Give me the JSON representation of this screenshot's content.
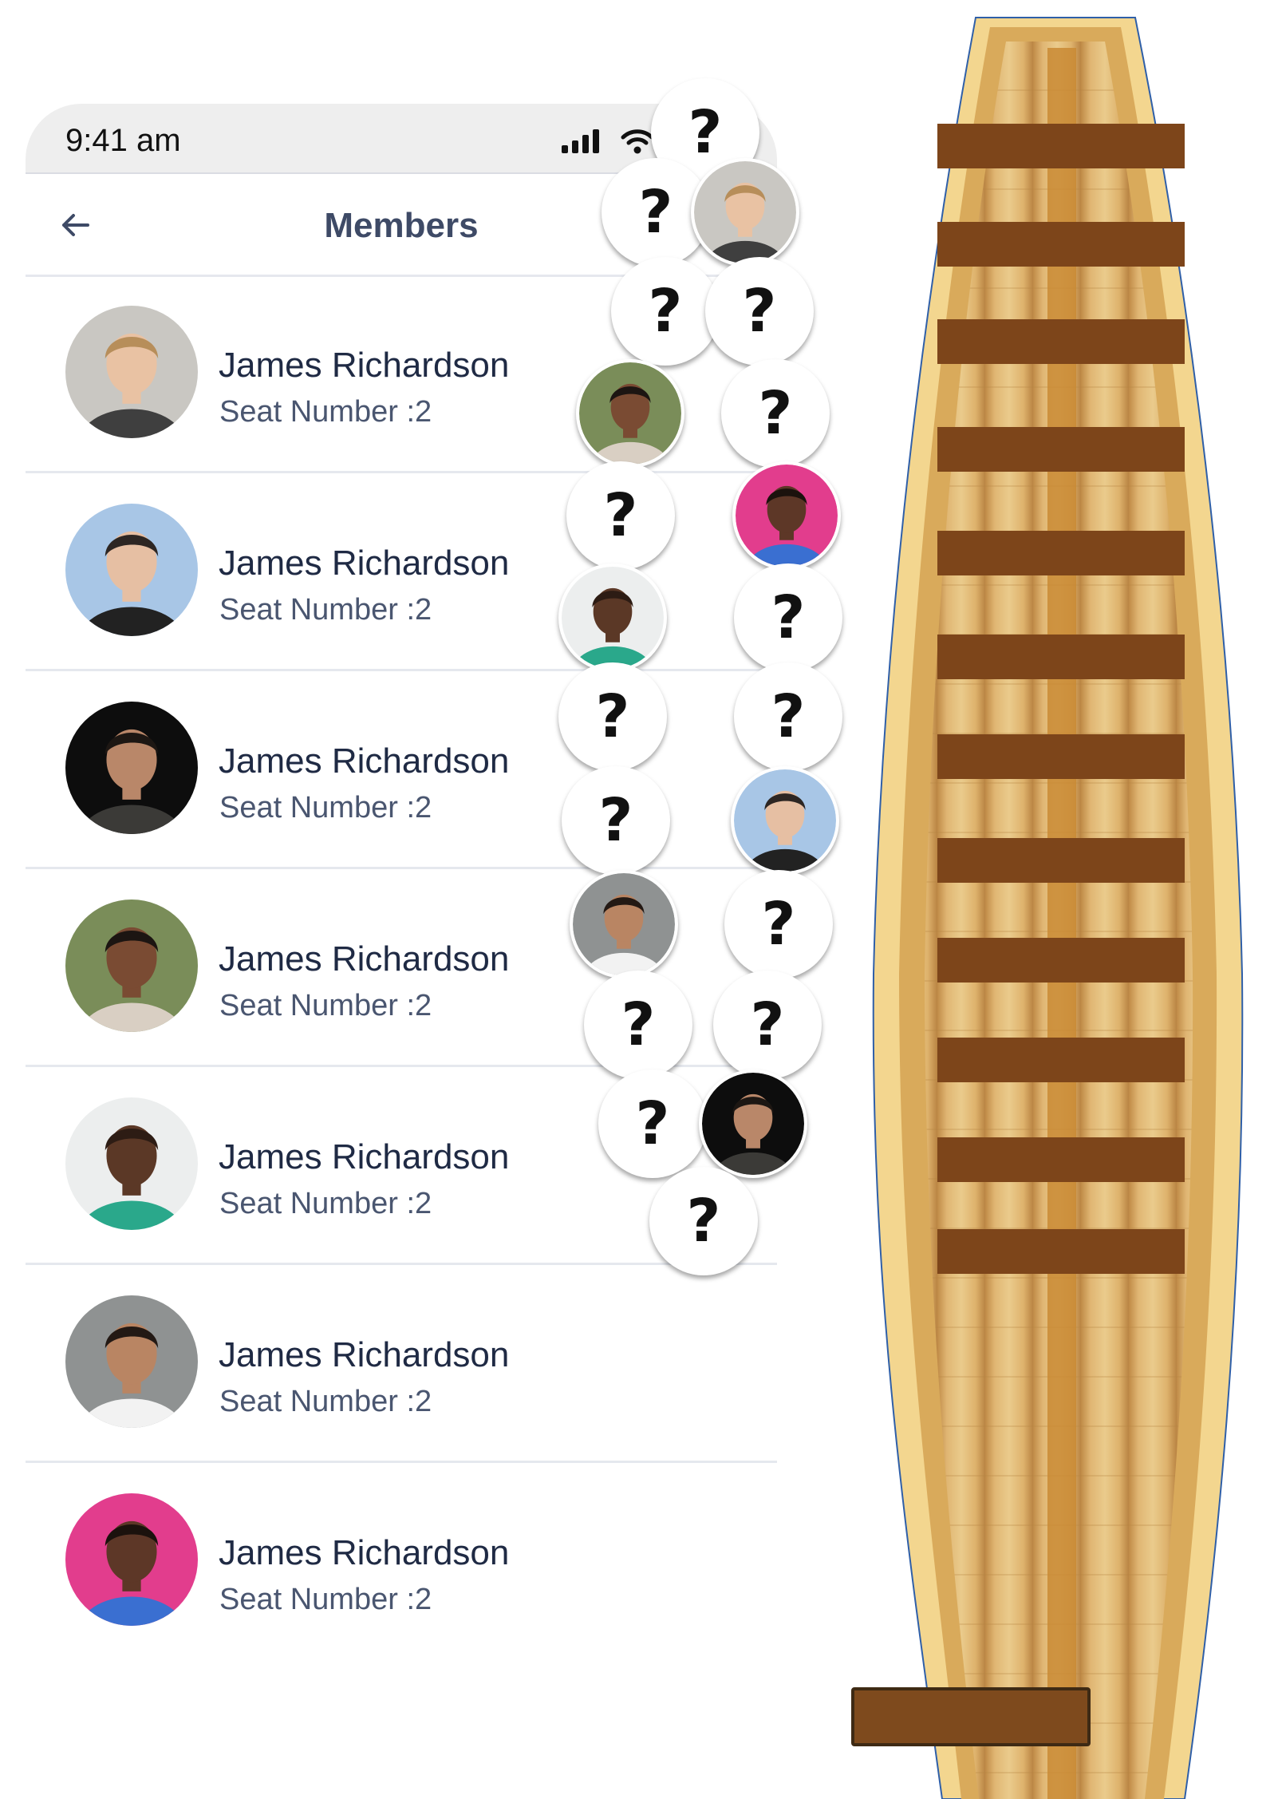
{
  "status_bar": {
    "time": "9:41 am"
  },
  "header": {
    "title": "Members"
  },
  "members": [
    {
      "name": "James Richardson",
      "seat": "Seat Number :2",
      "avatar": {
        "bg": "#c9c7c2",
        "skin": "#e9c2a3",
        "hair": "#b78e5a",
        "shirt": "#3f3f3f"
      }
    },
    {
      "name": "James Richardson",
      "seat": "Seat Number :2",
      "avatar": {
        "bg": "#a8c6e6",
        "skin": "#e6bfa3",
        "hair": "#2d2623",
        "shirt": "#222222"
      }
    },
    {
      "name": "James Richardson",
      "seat": "Seat Number :2",
      "avatar": {
        "bg": "#0d0d0d",
        "skin": "#b98769",
        "hair": "#1d1713",
        "shirt": "#3b3a37"
      }
    },
    {
      "name": "James Richardson",
      "seat": "Seat Number :2",
      "avatar": {
        "bg": "#7a8d59",
        "skin": "#7a4b33",
        "hair": "#1c1512",
        "shirt": "#d9cfc3"
      }
    },
    {
      "name": "James Richardson",
      "seat": "Seat Number :2",
      "avatar": {
        "bg": "#eceeee",
        "skin": "#5b3826",
        "hair": "#2d1c14",
        "shirt": "#2aa88b"
      }
    },
    {
      "name": "James Richardson",
      "seat": "Seat Number :2",
      "avatar": {
        "bg": "#8f9292",
        "skin": "#b98563",
        "hair": "#231914",
        "shirt": "#f2f2f2"
      }
    },
    {
      "name": "James Richardson",
      "seat": "Seat Number :2",
      "avatar": {
        "bg": "#e23d8d",
        "skin": "#5d3727",
        "hair": "#1b120d",
        "shirt": "#3a6fd1"
      }
    }
  ],
  "boat": {
    "empty_seat_label": "?",
    "seats": [
      {
        "state": "empty"
      },
      {
        "state": "empty"
      },
      {
        "state": "taken",
        "member": 0
      },
      {
        "state": "empty"
      },
      {
        "state": "empty"
      },
      {
        "state": "taken",
        "member": 3
      },
      {
        "state": "empty"
      },
      {
        "state": "empty"
      },
      {
        "state": "taken",
        "member": 6
      },
      {
        "state": "taken",
        "member": 4
      },
      {
        "state": "empty"
      },
      {
        "state": "empty"
      },
      {
        "state": "empty"
      },
      {
        "state": "empty"
      },
      {
        "state": "taken",
        "member": 1
      },
      {
        "state": "taken",
        "member": 5
      },
      {
        "state": "empty"
      },
      {
        "state": "empty"
      },
      {
        "state": "empty"
      },
      {
        "state": "empty"
      },
      {
        "state": "taken",
        "member": 2
      },
      {
        "state": "empty"
      }
    ]
  }
}
